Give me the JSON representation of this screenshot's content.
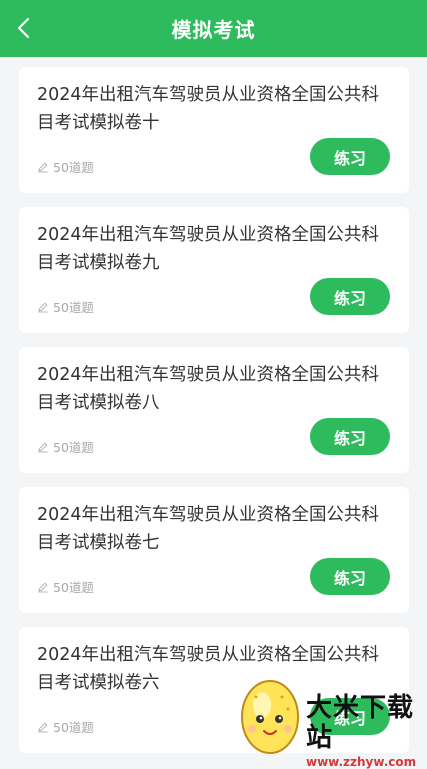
{
  "header": {
    "title": "模拟考试",
    "back_icon": "chevron-left-icon"
  },
  "colors": {
    "brand_green": "#2dbb5d",
    "background": "#f4f5f7",
    "card": "#ffffff",
    "meta_text": "#a9a9a9"
  },
  "exams": [
    {
      "title": "2024年出租汽车驾驶员从业资格全国公共科目考试模拟卷十",
      "question_count": "50道题",
      "action_label": "练习"
    },
    {
      "title": "2024年出租汽车驾驶员从业资格全国公共科目考试模拟卷九",
      "question_count": "50道题",
      "action_label": "练习"
    },
    {
      "title": "2024年出租汽车驾驶员从业资格全国公共科目考试模拟卷八",
      "question_count": "50道题",
      "action_label": "练习"
    },
    {
      "title": "2024年出租汽车驾驶员从业资格全国公共科目考试模拟卷七",
      "question_count": "50道题",
      "action_label": "练习"
    },
    {
      "title": "2024年出租汽车驾驶员从业资格全国公共科目考试模拟卷六",
      "question_count": "50道题",
      "action_label": "练习"
    }
  ],
  "watermark": {
    "name": "大米下载站",
    "url": "www.zzhyw.com"
  }
}
